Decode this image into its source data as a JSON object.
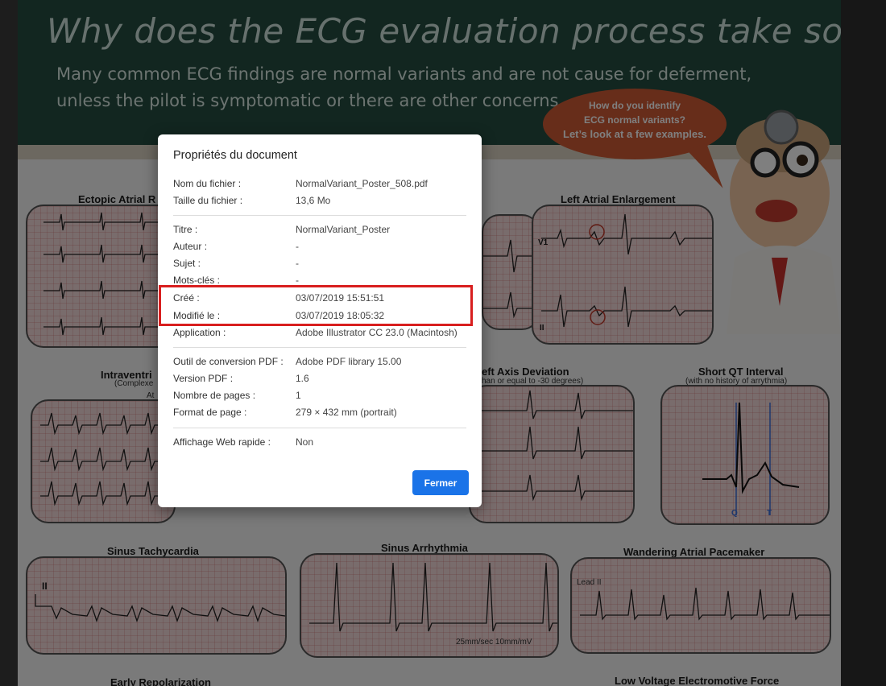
{
  "poster": {
    "headline": "Why does the ECG  evaluation process take so long?",
    "subline_1": "Many common ECG findings are normal variants and are not cause for deferment,",
    "subline_2": "unless the pilot is symptomatic or there are other concerns.",
    "bubble_line_1": "How do you identify",
    "bubble_line_2": "ECG normal variants?",
    "bubble_line_3": "Let’s look at a few examples.",
    "sections": {
      "ectopic": "Ectopic Atrial R",
      "left_atrial": "Left Atrial Enlargement",
      "left_atrial_lead": "V1",
      "left_atrial_lead2": "II",
      "intraventricular": "Intraventri",
      "intraventricular_sub": "(Complexe",
      "intraventricular_sub2": "At",
      "left_axis": "eft Axis Deviation",
      "left_axis_sub": "han or equal to -30 degrees)",
      "short_qt": "Short QT Interval",
      "short_qt_sub": "(with no history of arrythmia)",
      "short_qt_q": "Q",
      "short_qt_t": "T",
      "sinus_tachy": "Sinus Tachycardia",
      "sinus_tachy_lead": "II",
      "sinus_arrhythmia": "Sinus Arrhythmia",
      "sinus_arrhythmia_note": "25mm/sec 10mm/mV",
      "wandering": "Wandering Atrial Pacemaker",
      "wandering_lead": "Lead II",
      "early_repol": "Early Repolarization",
      "low_voltage": "Low Voltage Electromotive Force"
    }
  },
  "dialog": {
    "title": "Propriétés du document",
    "rows": [
      {
        "label": "Nom du fichier :",
        "value": "NormalVariant_Poster_508.pdf"
      },
      {
        "label": "Taille du fichier :",
        "value": "13,6 Mo"
      },
      {
        "label": "Titre :",
        "value": "NormalVariant_Poster"
      },
      {
        "label": "Auteur :",
        "value": "-"
      },
      {
        "label": "Sujet :",
        "value": "-"
      },
      {
        "label": "Mots-clés :",
        "value": "-"
      },
      {
        "label": "Créé :",
        "value": "03/07/2019 15:51:51"
      },
      {
        "label": "Modifié le :",
        "value": "03/07/2019 18:05:32"
      },
      {
        "label": "Application :",
        "value": "Adobe Illustrator CC 23.0 (Macintosh)"
      },
      {
        "label": "Outil de conversion PDF :",
        "value": "Adobe PDF library 15.00"
      },
      {
        "label": "Version PDF :",
        "value": "1.6"
      },
      {
        "label": "Nombre de pages :",
        "value": "1"
      },
      {
        "label": "Format de page :",
        "value": "279 × 432 mm (portrait)"
      },
      {
        "label": "Affichage Web rapide :",
        "value": "Non"
      }
    ],
    "close_label": "Fermer"
  },
  "colors": {
    "accent": "#1a73e8",
    "highlight": "#d81e1e",
    "board": "#244c40"
  }
}
